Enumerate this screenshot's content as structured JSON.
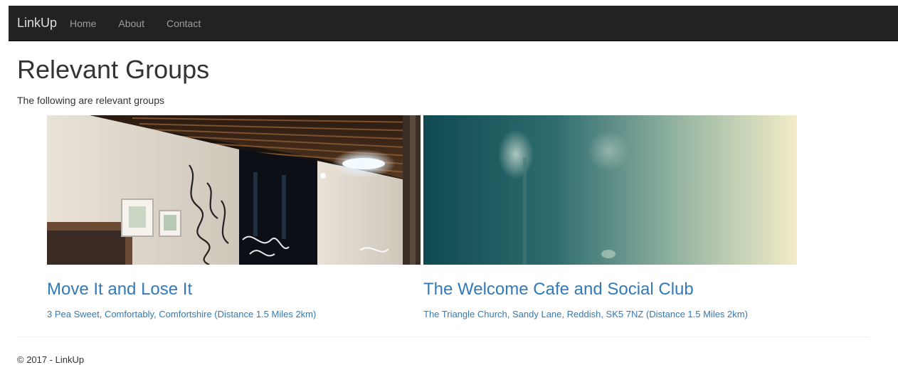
{
  "navbar": {
    "brand": "LinkUp",
    "links": [
      {
        "label": "Home"
      },
      {
        "label": "About"
      },
      {
        "label": "Contact"
      }
    ]
  },
  "page": {
    "title": "Relevant Groups",
    "subtitle": "The following are relevant groups"
  },
  "groups": [
    {
      "name": "Move It and Lose It",
      "address": "3 Pea Sweet, Comfortably, Comfortshire (Distance 1.5 Miles 2km)"
    },
    {
      "name": "The Welcome Cafe and Social Club",
      "address": "The Triangle Church, Sandy Lane, Reddish, SK5 7NZ (Distance 1.5 Miles 2km)"
    }
  ],
  "footer": {
    "text": "© 2017 - LinkUp"
  },
  "colors": {
    "navbar_bg": "#222222",
    "link": "#337ab7"
  }
}
